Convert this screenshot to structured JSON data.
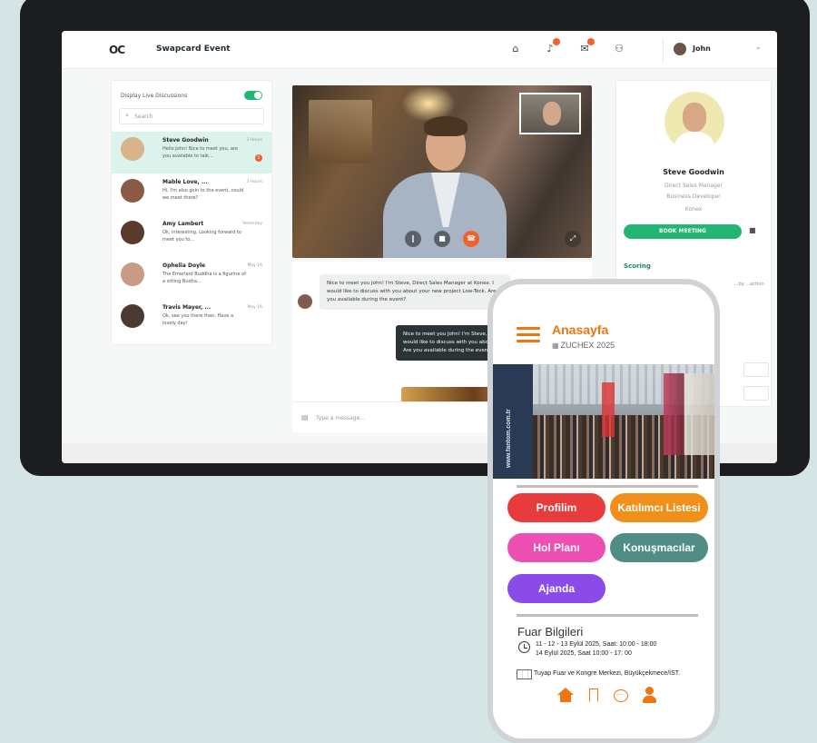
{
  "desktop": {
    "app_title": "Swapcard Event",
    "logo": "OC",
    "nav_icons": [
      "home-icon",
      "bell-icon",
      "chat-icon",
      "people-icon"
    ],
    "user_name": "John",
    "sidebar": {
      "live_label": "Display Live Discussions",
      "search_placeholder": "Search",
      "conversations": [
        {
          "name": "Steve Goodwin",
          "time": "2 Hours",
          "message": "Hello John! Nice to meet you, are you available to talk...",
          "unread": "1",
          "avatar_color": "#d8b48a"
        },
        {
          "name": "Mable Love, ...",
          "time": "3 Hours",
          "message": "Hi, I'm also goin to the event, could we meet there?",
          "avatar_color": "#8a5a46"
        },
        {
          "name": "Amy Lambert",
          "time": "Yesterday",
          "message": "Ok, interesting. Looking forward to meet you to...",
          "avatar_color": "#5a3a2a"
        },
        {
          "name": "Ophelia Doyle",
          "time": "May 16",
          "message": "The Emerlard Buddha is a figurine of a sitting Budha...",
          "avatar_color": "#c99a84"
        },
        {
          "name": "Travis Mayer, ...",
          "time": "May 16",
          "message": "Ok, see you there then. Have a lovely day!",
          "avatar_color": "#4a3a30"
        }
      ]
    },
    "chat": {
      "incoming": "Nice to meet you John! I'm Steve, Direct Sales Manager at Konex. I would like to discuss with you about your new project Low-Teck. Are you available during the event?",
      "outgoing": "Nice to meet you John! I'm Steve, Direct Sales Manager at Konex. I would like to discuss with you about your new project Low-Teck. Are you available during the event?",
      "composer_placeholder": "Type a message..."
    },
    "profile": {
      "name": "Steve Goodwin",
      "title": "Direct Sales Manager",
      "subtitle": "Business Developer",
      "company": "Konex",
      "book_button": "BOOK MEETING",
      "section": "Scoring",
      "text": "...by ...action"
    }
  },
  "phone": {
    "title": "Anasayfa",
    "event": "ZUCHEX 2025",
    "hero_caption": "www.fantom.com.tr",
    "buttons": [
      {
        "label": "Profilim",
        "color": "#e83b3b"
      },
      {
        "label": "Katılımcı Listesi",
        "color": "#f0901a"
      },
      {
        "label": "Hol Planı",
        "color": "#ee4fb2"
      },
      {
        "label": "Konuşmacılar",
        "color": "#4f8d86"
      },
      {
        "label": "Ajanda",
        "color": "#8a4be8"
      }
    ],
    "fair_info": {
      "heading": "Fuar Bilgileri",
      "dates_line1": "11 - 12 - 13 Eylül 2025, Saat: 10:00 - 18:00",
      "dates_line2": "14 Eylül 2025, Saat 10:00 - 17: 00",
      "venue": "Tuyap Fuar ve Kongre Merkezi, Büyükçekmece/İST."
    },
    "bottom_nav": [
      "home-icon",
      "bookmark-icon",
      "chat-icon",
      "user-icon"
    ],
    "accent_color": "#f07410"
  }
}
